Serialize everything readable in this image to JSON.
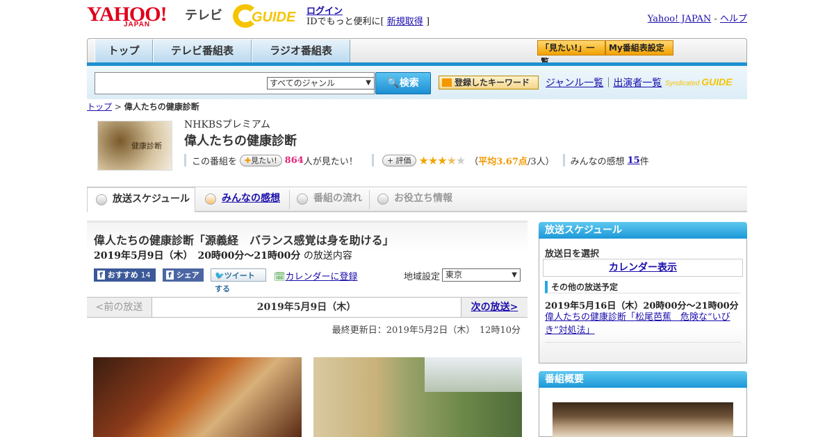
{
  "header": {
    "yahoo": "YAHOO!",
    "japan": "JAPAN",
    "tv": "テレビ",
    "guide": "GUIDE",
    "login": "ログイン",
    "login_sub_prefix": "IDでもっと便利に[",
    "signup": "新規取得",
    "login_sub_suffix": "]",
    "yahoo_japan_link": "Yahoo! JAPAN",
    "separator": " - ",
    "help_link": "ヘルプ"
  },
  "nav": {
    "tabs": [
      "トップ",
      "テレビ番組表",
      "ラジオ番組表"
    ],
    "mitai_list": "「見たい!」一覧",
    "my_settings": "My番組表設定"
  },
  "search": {
    "input_value": "",
    "genre_selected": "すべてのジャンル",
    "button": "検索",
    "keyword_button": "登録したキーワード",
    "genre_list": "ジャンル一覧",
    "divider": "｜",
    "performer_list": "出演者一覧",
    "syndicated": "Syndicated"
  },
  "breadcrumb": {
    "top": "トップ",
    "sep": " > ",
    "current": "偉人たちの健康診断"
  },
  "program": {
    "thumb_label": "健康診断",
    "channel": "NHKBSプレミアム",
    "title": "偉人たちの健康診断",
    "this_program": "この番組を",
    "mitai_pill": "見たい!",
    "mitai_count": "864",
    "mitai_suffix": "人が見たい！",
    "rating_pill": "評価",
    "rating_stars": 3.67,
    "avg_prefix": "（",
    "avg_label": "平均3.67点",
    "avg_suffix": "/3人）",
    "impression_label": "みんなの感想",
    "impression_count": "15",
    "impression_suffix": "件"
  },
  "tabs": [
    "放送スケジュール",
    "みんなの感想",
    "番組の流れ",
    "お役立ち情報"
  ],
  "episode": {
    "title": "偉人たちの健康診断「源義経　バランス感覚は身を助ける」",
    "datetime": "2019年5月9日（木）　20時00分～21時00分",
    "datetime_suffix": "の放送内容",
    "recommend": "おすすめ",
    "recommend_count": "14",
    "share": "シェア",
    "tweet": "ツイートする",
    "calendar": "カレンダーに登録",
    "region_label": "地域設定",
    "region_value": "東京"
  },
  "pager": {
    "prev": "<前の放送",
    "current": "2019年5月9日（木）",
    "next": "次の放送>"
  },
  "updated": "最終更新日：2019年5月2日（木）　12時10分",
  "sidebar": {
    "schedule_head": "放送スケジュール",
    "select_date": "放送日を選択",
    "calendar_button": "カレンダー表示",
    "other_head": "その他の放送予定",
    "other_date": "2019年5月16日（木）20時00分～21時00分",
    "other_link": "偉人たちの健康診断「松尾芭蕉　危険な“いびき”対処法」",
    "overview_head": "番組概要"
  },
  "colors": {
    "accent_blue": "#1e90d0",
    "link": "#1a0dab",
    "star": "#f0a500",
    "yahoo_red": "#e0001b"
  }
}
